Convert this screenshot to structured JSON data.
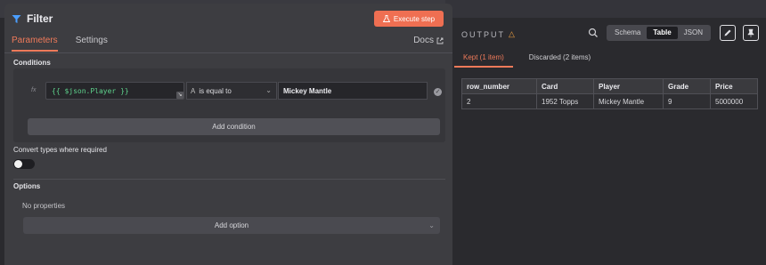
{
  "node": {
    "title": "Filter",
    "execute_label": "Execute step",
    "tabs": [
      "Parameters",
      "Settings"
    ],
    "docs_label": "Docs"
  },
  "conditions": {
    "section_label": "Conditions",
    "fx_label": "fx",
    "expression": "{{ $json.Player }}",
    "operator": "is equal to",
    "operator_icon": "A",
    "value": "Mickey Mantle",
    "add_label": "Add condition"
  },
  "convert": {
    "label": "Convert types where required",
    "enabled": false
  },
  "options": {
    "section_label": "Options",
    "empty_label": "No properties",
    "add_label": "Add option"
  },
  "output": {
    "label": "OUTPUT",
    "views": [
      "Schema",
      "Table",
      "JSON"
    ],
    "active_view": "Table",
    "tabs": [
      "Kept (1 item)",
      "Discarded (2 items)"
    ],
    "columns": [
      "row_number",
      "Card",
      "Player",
      "Grade",
      "Price"
    ],
    "rows": [
      [
        "2",
        "1952 Topps",
        "Mickey Mantle",
        "9",
        "5000000"
      ]
    ]
  },
  "colors": {
    "accent": "#ef6f52",
    "expression": "#5fd38d",
    "warning": "#f0a040"
  }
}
